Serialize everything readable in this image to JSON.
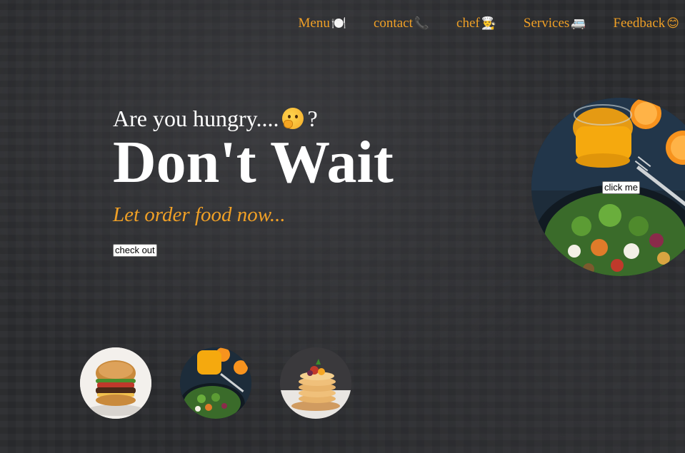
{
  "nav": {
    "items": [
      {
        "label": "Menu",
        "emoji": "🍽️"
      },
      {
        "label": "contact",
        "emoji": "📞"
      },
      {
        "label": "chef",
        "emoji": "👨‍🍳"
      },
      {
        "label": "Services",
        "emoji": "🚐"
      },
      {
        "label": "Feedback",
        "emoji": "😊"
      }
    ]
  },
  "hero": {
    "question_text": "Are you hungry....",
    "question_mark": "?",
    "headline": "Don't Wait",
    "tagline": "Let order food now...",
    "checkout_label": "check out"
  },
  "featured": {
    "button_label": "click me",
    "image": "orange-juice-and-salad-photo"
  },
  "thumbnails": [
    {
      "image": "burger-photo"
    },
    {
      "image": "orange-juice-and-salad-photo"
    },
    {
      "image": "pancake-stack-photo"
    }
  ],
  "colors": {
    "accent": "#f0a026",
    "text": "#ffffff",
    "background": "#2a2b2e"
  }
}
